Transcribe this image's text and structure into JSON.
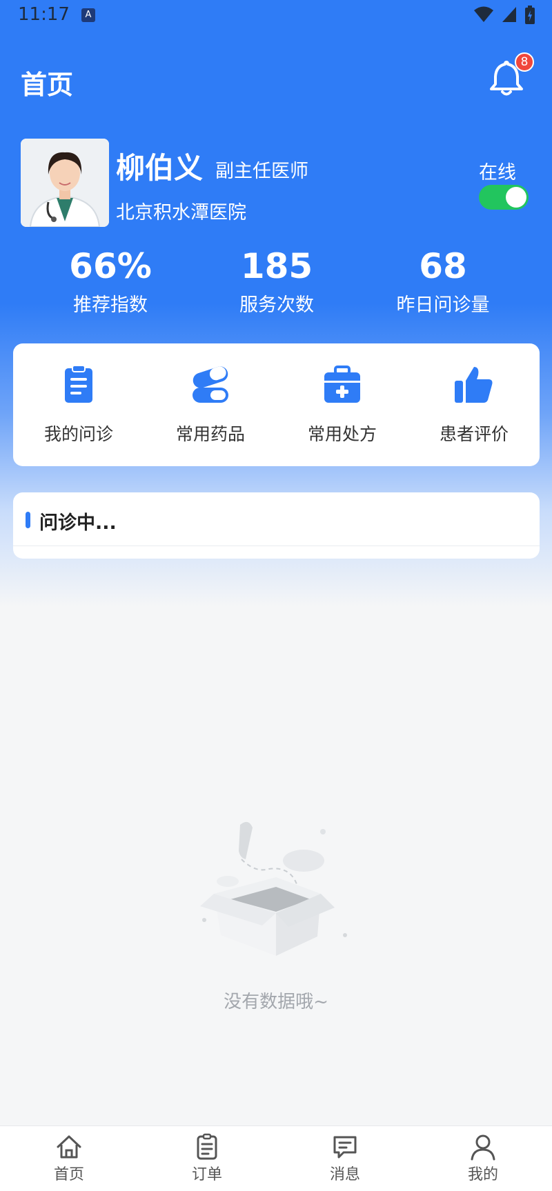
{
  "status_bar": {
    "time": "11:17",
    "app_icon_letter": "A"
  },
  "header": {
    "title": "首页",
    "notification_count": "8"
  },
  "profile": {
    "name": "柳伯义",
    "title": "副主任医师",
    "hospital": "北京积水潭医院",
    "online_label": "在线",
    "online": true
  },
  "stats": [
    {
      "value": "66%",
      "label": "推荐指数"
    },
    {
      "value": "185",
      "label": "服务次数"
    },
    {
      "value": "68",
      "label": "昨日问诊量"
    }
  ],
  "menu": [
    {
      "label": "我的问诊",
      "icon": "clipboard-icon"
    },
    {
      "label": "常用药品",
      "icon": "pill-icon"
    },
    {
      "label": "常用处方",
      "icon": "medical-kit-icon"
    },
    {
      "label": "患者评价",
      "icon": "thumbs-up-icon"
    }
  ],
  "consult": {
    "title": "问诊中..."
  },
  "empty_state": {
    "text": "没有数据哦~"
  },
  "tabbar": [
    {
      "label": "首页",
      "icon": "home-icon"
    },
    {
      "label": "订单",
      "icon": "order-list-icon"
    },
    {
      "label": "消息",
      "icon": "message-icon"
    },
    {
      "label": "我的",
      "icon": "user-icon"
    }
  ],
  "colors": {
    "primary": "#2f7cf6",
    "toggle_on": "#22c55e",
    "badge": "#f0473d"
  }
}
